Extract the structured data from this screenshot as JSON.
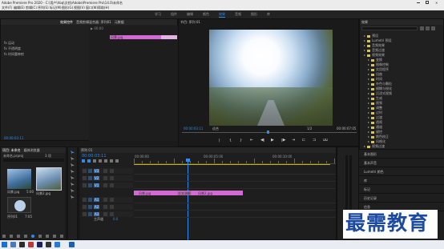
{
  "app": {
    "title": "Adobe Premiere Pro 2020 - C:\\用户\\hbq\\文档\\Adobe\\Premiere Pro\\14.0\\未命名"
  },
  "menu": [
    "文件(F)",
    "编辑(E)",
    "剪辑(C)",
    "序列(S)",
    "标记(M)",
    "图形(G)",
    "视图(V)",
    "窗口(W)",
    "帮助(H)"
  ],
  "workspaces": [
    "学习",
    "组件",
    "编辑",
    "颜色",
    "效果",
    "音频",
    "图形",
    "库"
  ],
  "active_workspace": "效果",
  "effect_controls": {
    "tabs": [
      "效果控件",
      "音频剪辑混合器: 序列01",
      "元数据"
    ],
    "rows": [
      "fx  运动",
      "fx  不透明度",
      "fx  时间重映射"
    ],
    "clip_label": "风景.jpg",
    "time": "00:00:03:11"
  },
  "program": {
    "title": "节目: 序列 01",
    "timecode": "00:00:03:11",
    "fit": "适合",
    "ratio": "1/2",
    "duration": "00:00:07:05"
  },
  "effects": {
    "title": "效果",
    "items": [
      "预设",
      "Lumetri 预设",
      "音频效果",
      "音频过渡",
      "视频效果",
      "变换",
      "图像控制",
      "实用程序",
      "扭曲",
      "时间",
      "杂色与颗粒",
      "模糊与锐化",
      "沉浸式视频",
      "生成",
      "视频",
      "调整",
      "过时",
      "过渡",
      "透视",
      "通道",
      "键控",
      "颜色校正",
      "风格化",
      "视频过渡"
    ],
    "panels": [
      "基本图形",
      "基本声音",
      "Lumetri 颜色",
      "库",
      "标记",
      "历史记录",
      "信息"
    ]
  },
  "project": {
    "tabs": [
      "项目: 未命名",
      "媒体浏览器"
    ],
    "file": "未命名.prproj",
    "count": "3 项",
    "items": [
      {
        "name": "风景.jpg",
        "dur": "5:00"
      },
      {
        "name": "风景2.jpg",
        "dur": "5:00"
      },
      {
        "name": "序列01",
        "dur": "7:05"
      }
    ]
  },
  "timeline": {
    "title": "序列 01",
    "timecode": "00:00:03:11",
    "ruler": [
      "00:00:00",
      "00:00:05:00",
      "00:00:10:00"
    ],
    "tracks": [
      "V3",
      "V2",
      "V1",
      "A1",
      "A2",
      "A3"
    ],
    "master": "主声道",
    "master_val": "0.0",
    "clips": [
      {
        "name": "风景.jpg"
      },
      {
        "name": "交叉溶解"
      },
      {
        "name": "风景2.jpg"
      }
    ]
  },
  "taskbar": {
    "time": "9:13",
    "date": "2021/10/15"
  },
  "watermark": "最需教育",
  "colors": {
    "accent": "#2d8ceb",
    "clip": "#d36ad3",
    "folder": "#d8c25a"
  }
}
